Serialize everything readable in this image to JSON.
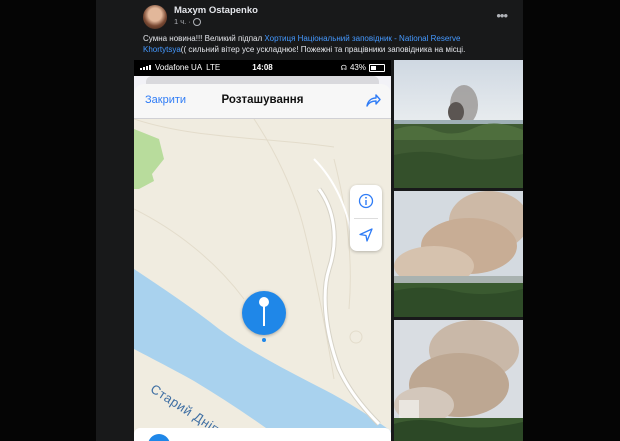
{
  "post": {
    "author": "Maxym Ostapenko",
    "time": "1 ч.",
    "menu_icon": "more-dots-icon",
    "text_before": "Сумна новина!!! Великий підпал ",
    "link_text": "Хортиця Національний заповідник - National Reserve Khortytsya",
    "text_after": "(( сильний вітер усе ускладнює! Пожежні та працівники заповідника на місці."
  },
  "phone": {
    "carrier": "Vodafone UA",
    "network": "LTE",
    "time": "14:08",
    "battery": "43%"
  },
  "location_sheet": {
    "close_label": "Закрити",
    "title": "Розташування",
    "share_icon": "share-icon",
    "info_icon": "info-icon",
    "locate_icon": "location-arrow-icon",
    "pin_icon": "map-pin-icon"
  },
  "map": {
    "river_label": "Старий Дніпро",
    "colors": {
      "land": "#f0ece0",
      "water": "#a9d2ee",
      "park": "#b8dc9c",
      "road": "#ffffff",
      "pin": "#1f87e8"
    }
  },
  "photos": [
    {
      "name": "forest-smoke-distant"
    },
    {
      "name": "forest-smoke-close"
    },
    {
      "name": "forest-smoke-plume"
    }
  ]
}
